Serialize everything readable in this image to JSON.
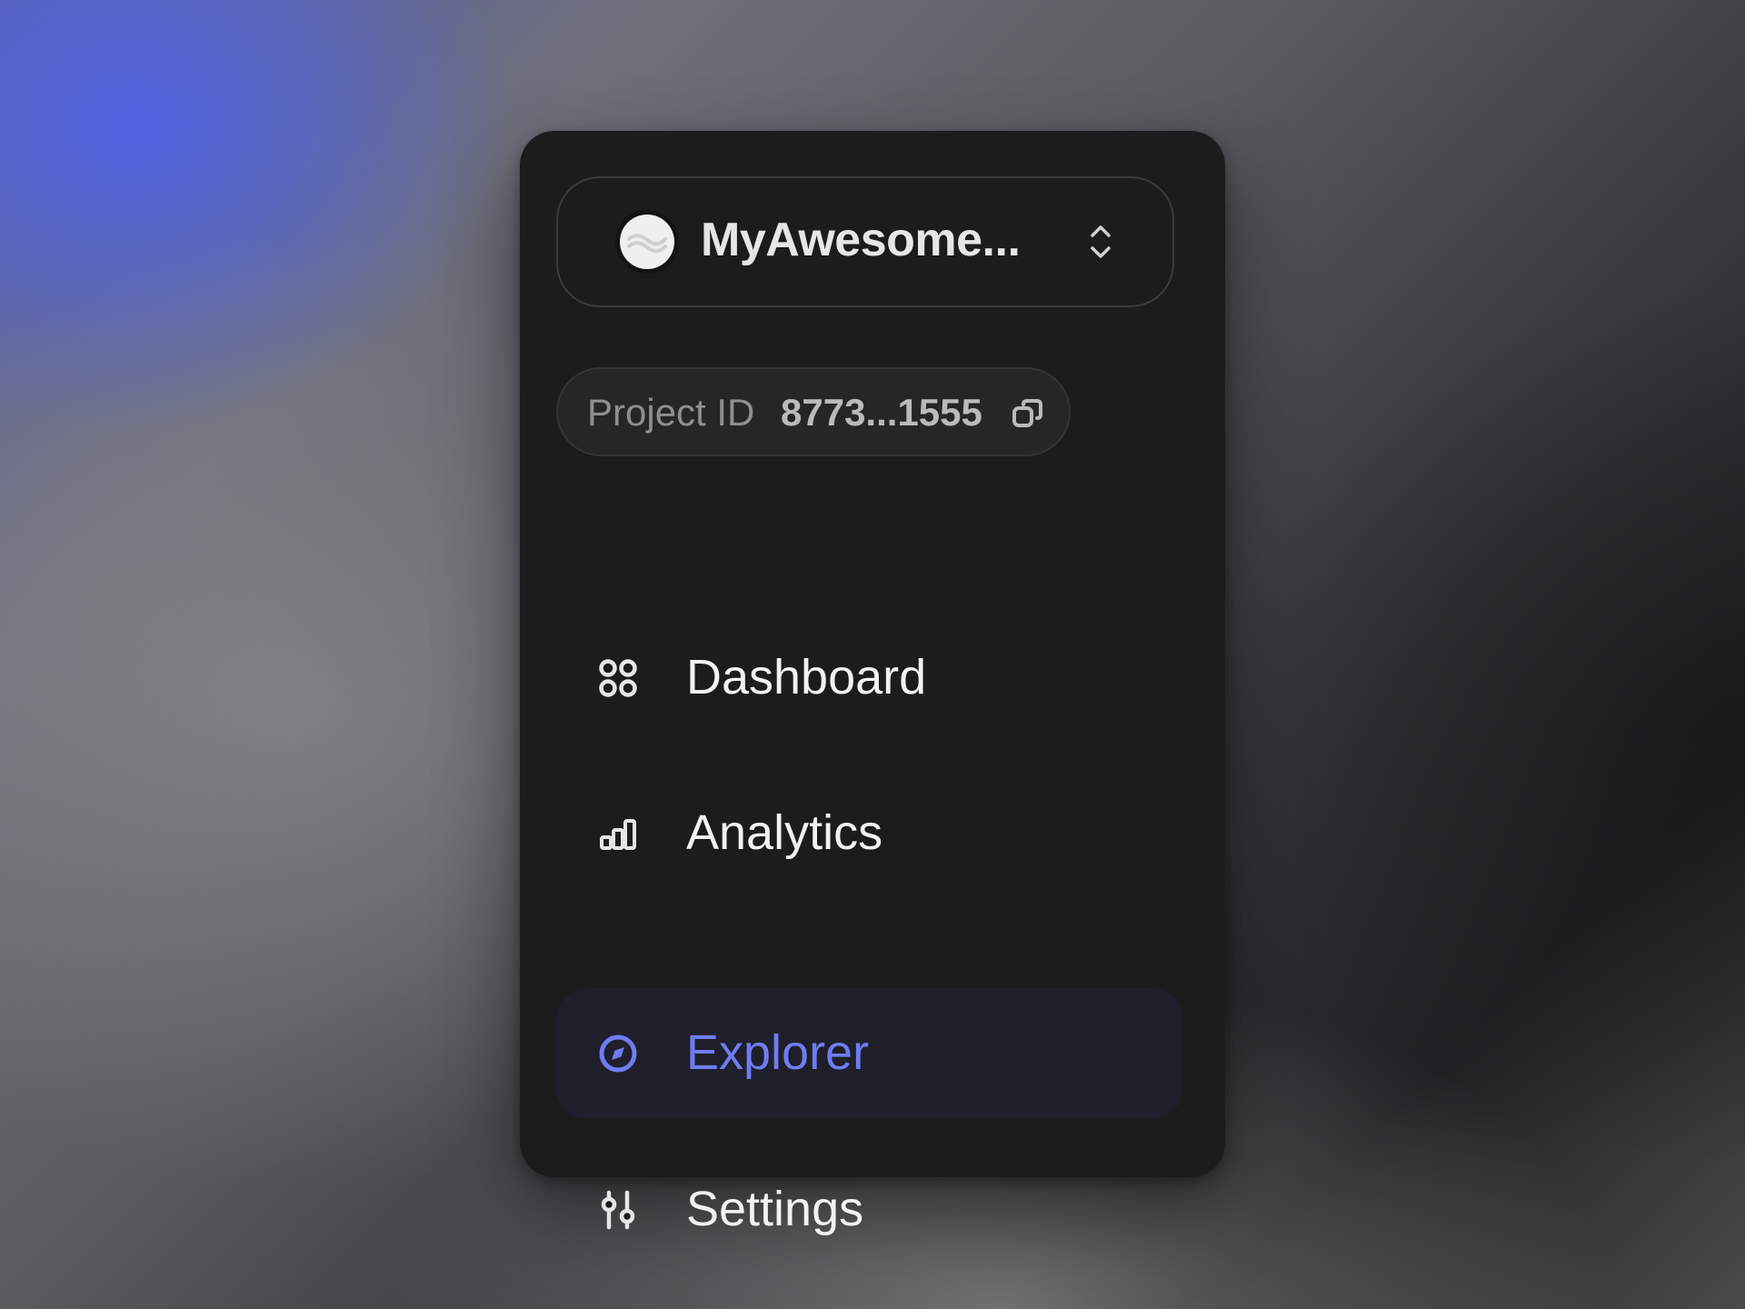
{
  "project_switcher": {
    "name": "MyAwesome...",
    "avatar_icon": "wave-logo-icon",
    "toggle_icon": "chevron-up-down-icon"
  },
  "project_id": {
    "label": "Project ID",
    "value": "8773...1555",
    "copy_icon": "copy-icon"
  },
  "nav": {
    "items": [
      {
        "label": "Dashboard",
        "icon": "grid-icon",
        "active": false
      },
      {
        "label": "Analytics",
        "icon": "bar-chart-icon",
        "active": false
      },
      {
        "label": "Explorer",
        "icon": "compass-icon",
        "active": true
      },
      {
        "label": "Settings",
        "icon": "sliders-icon",
        "active": false
      }
    ]
  },
  "colors": {
    "accent": "#6f7cf2",
    "panel_bg": "#1b1c1c",
    "active_item_bg": "#1e1f2a",
    "text_primary": "#f2f2f2",
    "text_muted": "#8e8f90"
  }
}
